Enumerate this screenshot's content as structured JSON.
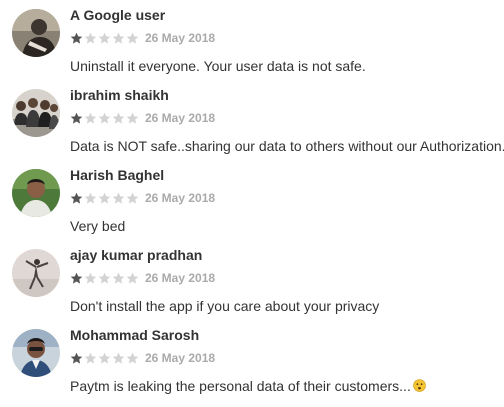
{
  "reviews": [
    {
      "author": "A Google user",
      "rating": 1,
      "max_rating": 5,
      "date": "26 May 2018",
      "text": "Uninstall it everyone. Your user data is not safe.",
      "avatar_icon": "person-photo-avatar-icon"
    },
    {
      "author": "ibrahim shaikh",
      "rating": 1,
      "max_rating": 5,
      "date": "26 May 2018",
      "text": "Data is NOT safe..sharing our data to others without our Authorization.",
      "avatar_icon": "group-photo-avatar-icon"
    },
    {
      "author": "Harish Baghel",
      "rating": 1,
      "max_rating": 5,
      "date": "26 May 2018",
      "text": "Very bed",
      "avatar_icon": "person-photo-avatar-icon"
    },
    {
      "author": "ajay kumar pradhan",
      "rating": 1,
      "max_rating": 5,
      "date": "26 May 2018",
      "text": "Don't install the app if you care about your privacy",
      "avatar_icon": "jumping-person-avatar-icon"
    },
    {
      "author": "Mohammad Sarosh",
      "rating": 1,
      "max_rating": 5,
      "date": "26 May 2018",
      "text": "Paytm is leaking the personal data of their customers...",
      "avatar_icon": "person-photo-avatar-icon",
      "trailing_icon": "worried-face-emoji-icon"
    }
  ],
  "colors": {
    "star_filled": "#555555",
    "star_empty": "#d3d3d3",
    "date_text": "#aaaaaa",
    "body_text": "#333333",
    "emoji_face": "#f5c531"
  }
}
